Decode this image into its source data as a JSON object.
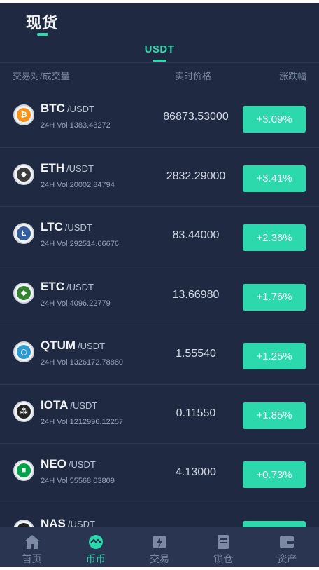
{
  "header": {
    "title": "现货",
    "market_tab": "USDT"
  },
  "columns": {
    "pair": "交易对/成交量",
    "price": "实时价格",
    "change": "涨跌幅"
  },
  "coins": [
    {
      "symbol": "BTC",
      "quote": "/USDT",
      "volume": "24H Vol 1383.43272",
      "price": "86873.53000",
      "change": "+3.09%",
      "icon": "bitcoin-icon",
      "color": "#f7931a"
    },
    {
      "symbol": "ETH",
      "quote": "/USDT",
      "volume": "24H Vol 20002.84794",
      "price": "2832.29000",
      "change": "+3.41%",
      "icon": "ethereum-icon",
      "color": "#3c3c3d"
    },
    {
      "symbol": "LTC",
      "quote": "/USDT",
      "volume": "24H Vol 292514.66676",
      "price": "83.44000",
      "change": "+2.36%",
      "icon": "litecoin-icon",
      "color": "#345d9d"
    },
    {
      "symbol": "ETC",
      "quote": "/USDT",
      "volume": "24H Vol 4096.22779",
      "price": "13.66980",
      "change": "+1.76%",
      "icon": "ethereum-classic-icon",
      "color": "#328332"
    },
    {
      "symbol": "QTUM",
      "quote": "/USDT",
      "volume": "24H Vol 1326172.78880",
      "price": "1.55540",
      "change": "+1.25%",
      "icon": "qtum-icon",
      "color": "#2e9ad0"
    },
    {
      "symbol": "IOTA",
      "quote": "/USDT",
      "volume": "24H Vol 1212996.12257",
      "price": "0.11550",
      "change": "+1.85%",
      "icon": "iota-icon",
      "color": "#242424"
    },
    {
      "symbol": "NEO",
      "quote": "/USDT",
      "volume": "24H Vol 55568.03809",
      "price": "4.13000",
      "change": "+0.73%",
      "icon": "neo-icon",
      "color": "#00a34a"
    },
    {
      "symbol": "NAS",
      "quote": "/USDT",
      "volume": "",
      "price": "",
      "change": "",
      "icon": "nas-icon",
      "color": "#222222"
    }
  ],
  "tabbar": [
    {
      "label": "首页",
      "icon": "home-icon"
    },
    {
      "label": "币币",
      "icon": "coin-exchange-icon",
      "active": true
    },
    {
      "label": "交易",
      "icon": "trade-icon"
    },
    {
      "label": "锁仓",
      "icon": "lock-position-icon"
    },
    {
      "label": "资产",
      "icon": "wallet-icon"
    }
  ],
  "colors": {
    "background": "#1f2a42",
    "accent": "#2bd9ad",
    "tabbar": "#2a3552"
  }
}
